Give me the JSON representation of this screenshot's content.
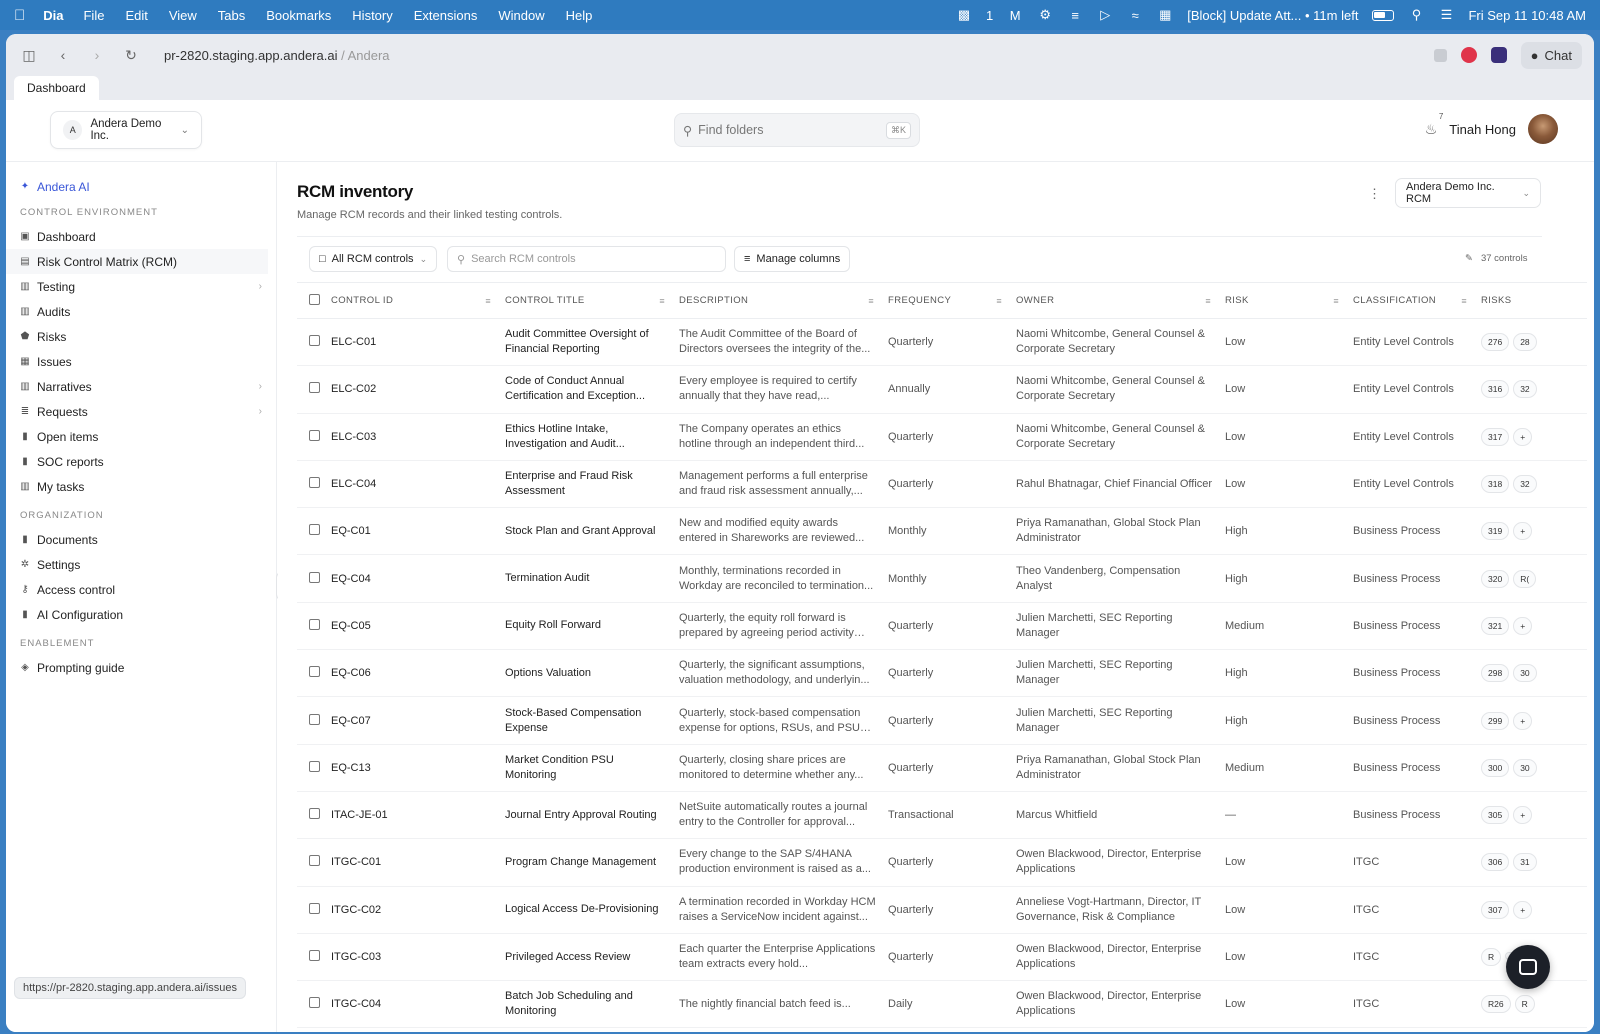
{
  "menubar": {
    "app": "Dia",
    "items": [
      "File",
      "Edit",
      "View",
      "Tabs",
      "Bookmarks",
      "History",
      "Extensions",
      "Window",
      "Help"
    ],
    "notif_count": "1",
    "meeting": "[Block] Update Att... • 11m left",
    "datetime": "Fri Sep 11  10:48 AM"
  },
  "browser": {
    "url_main": "pr-2820.staging.app.andera.ai",
    "url_sub": " / Andera",
    "chat_label": "Chat",
    "tab": "Dashboard",
    "status_url": "https://pr-2820.staging.app.andera.ai/issues"
  },
  "header": {
    "org_initial": "A",
    "org_name": "Andera Demo Inc.",
    "search_placeholder": "Find folders",
    "search_kbd": "⌘K",
    "notif_count": "7",
    "user_name": "Tinah Hong"
  },
  "sidebar": {
    "ai_label": "Andera AI",
    "section_control": "CONTROL ENVIRONMENT",
    "control_items": [
      {
        "label": "Dashboard",
        "icon": "▣"
      },
      {
        "label": "Risk Control Matrix (RCM)",
        "icon": "▤"
      },
      {
        "label": "Testing",
        "icon": "▥"
      },
      {
        "label": "Audits",
        "icon": "▥"
      },
      {
        "label": "Risks",
        "icon": "⬟"
      },
      {
        "label": "Issues",
        "icon": "▦"
      },
      {
        "label": "Narratives",
        "icon": "▥"
      },
      {
        "label": "Requests",
        "icon": "≣"
      },
      {
        "label": "Open items",
        "icon": "▮"
      },
      {
        "label": "SOC reports",
        "icon": "▮"
      },
      {
        "label": "My tasks",
        "icon": "▥"
      }
    ],
    "section_org": "ORGANIZATION",
    "org_items": [
      {
        "label": "Documents",
        "icon": "▮"
      },
      {
        "label": "Settings",
        "icon": "✲"
      },
      {
        "label": "Access control",
        "icon": "⚷"
      },
      {
        "label": "AI Configuration",
        "icon": "▮"
      }
    ],
    "section_enable": "ENABLEMENT",
    "enable_items": [
      {
        "label": "Prompting guide",
        "icon": "◈"
      }
    ]
  },
  "main": {
    "title": "RCM inventory",
    "subtitle": "Manage RCM records and their linked testing controls.",
    "rcm_select": "Andera Demo Inc. RCM",
    "filter_label": "All RCM controls",
    "search_placeholder": "Search RCM controls",
    "manage_columns": "Manage columns",
    "controls_count": "37 controls"
  },
  "table": {
    "headers": [
      "CONTROL ID",
      "CONTROL TITLE",
      "DESCRIPTION",
      "FREQUENCY",
      "OWNER",
      "RISK",
      "CLASSIFICATION",
      "RISKS"
    ],
    "rows": [
      {
        "id": "ELC-C01",
        "title": "Audit Committee Oversight of Financial Reporting",
        "desc": "The Audit Committee of the Board of Directors oversees the integrity of the...",
        "freq": "Quarterly",
        "owner": "Naomi Whitcombe, General Counsel & Corporate Secretary",
        "risk": "Low",
        "class": "Entity Level Controls",
        "risks": [
          "276",
          "28"
        ]
      },
      {
        "id": "ELC-C02",
        "title": "Code of Conduct Annual Certification and Exception...",
        "desc": "Every employee is required to certify annually that they have read,...",
        "freq": "Annually",
        "owner": "Naomi Whitcombe, General Counsel & Corporate Secretary",
        "risk": "Low",
        "class": "Entity Level Controls",
        "risks": [
          "316",
          "32"
        ]
      },
      {
        "id": "ELC-C03",
        "title": "Ethics Hotline Intake, Investigation and Audit...",
        "desc": "The Company operates an ethics hotline through an independent third...",
        "freq": "Quarterly",
        "owner": "Naomi Whitcombe, General Counsel & Corporate Secretary",
        "risk": "Low",
        "class": "Entity Level Controls",
        "risks": [
          "317",
          "+"
        ]
      },
      {
        "id": "ELC-C04",
        "title": "Enterprise and Fraud Risk Assessment",
        "desc": "Management performs a full enterprise and fraud risk assessment annually,...",
        "freq": "Quarterly",
        "owner": "Rahul Bhatnagar, Chief Financial Officer",
        "risk": "Low",
        "class": "Entity Level Controls",
        "risks": [
          "318",
          "32"
        ]
      },
      {
        "id": "EQ-C01",
        "title": "Stock Plan and Grant Approval",
        "desc": "New and modified equity awards entered in Shareworks are reviewed...",
        "freq": "Monthly",
        "owner": "Priya Ramanathan, Global Stock Plan Administrator",
        "risk": "High",
        "class": "Business Process",
        "risks": [
          "319",
          "+"
        ]
      },
      {
        "id": "EQ-C04",
        "title": "Termination Audit",
        "desc": "Monthly, terminations recorded in Workday are reconciled to termination...",
        "freq": "Monthly",
        "owner": "Theo Vandenberg, Compensation Analyst",
        "risk": "High",
        "class": "Business Process",
        "risks": [
          "320",
          "R("
        ]
      },
      {
        "id": "EQ-C05",
        "title": "Equity Roll Forward",
        "desc": "Quarterly, the equity roll forward is prepared by agreeing period activity —...",
        "freq": "Quarterly",
        "owner": "Julien Marchetti, SEC Reporting Manager",
        "risk": "Medium",
        "class": "Business Process",
        "risks": [
          "321",
          "+"
        ]
      },
      {
        "id": "EQ-C06",
        "title": "Options Valuation",
        "desc": "Quarterly, the significant assumptions, valuation methodology, and underlyin...",
        "freq": "Quarterly",
        "owner": "Julien Marchetti, SEC Reporting Manager",
        "risk": "High",
        "class": "Business Process",
        "risks": [
          "298",
          "30"
        ]
      },
      {
        "id": "EQ-C07",
        "title": "Stock-Based Compensation Expense",
        "desc": "Quarterly, stock-based compensation expense for options, RSUs, and PSUs i...",
        "freq": "Quarterly",
        "owner": "Julien Marchetti, SEC Reporting Manager",
        "risk": "High",
        "class": "Business Process",
        "risks": [
          "299",
          "+"
        ]
      },
      {
        "id": "EQ-C13",
        "title": "Market Condition PSU Monitoring",
        "desc": "Quarterly, closing share prices are monitored to determine whether any...",
        "freq": "Quarterly",
        "owner": "Priya Ramanathan, Global Stock Plan Administrator",
        "risk": "Medium",
        "class": "Business Process",
        "risks": [
          "300",
          "30"
        ]
      },
      {
        "id": "ITAC-JE-01",
        "title": "Journal Entry Approval Routing",
        "desc": "NetSuite automatically routes a journal entry to the Controller for approval...",
        "freq": "Transactional",
        "owner": "Marcus Whitfield",
        "risk": "—",
        "class": "Business Process",
        "risks": [
          "305",
          "+"
        ]
      },
      {
        "id": "ITGC-C01",
        "title": "Program Change Management",
        "desc": "Every change to the SAP S/4HANA production environment is raised as a...",
        "freq": "Quarterly",
        "owner": "Owen Blackwood, Director, Enterprise Applications",
        "risk": "Low",
        "class": "ITGC",
        "risks": [
          "306",
          "31"
        ]
      },
      {
        "id": "ITGC-C02",
        "title": "Logical Access De-Provisioning",
        "desc": "A termination recorded in Workday HCM raises a ServiceNow incident against...",
        "freq": "Quarterly",
        "owner": "Anneliese Vogt-Hartmann, Director, IT Governance, Risk & Compliance",
        "risk": "Low",
        "class": "ITGC",
        "risks": [
          "307",
          "+"
        ]
      },
      {
        "id": "ITGC-C03",
        "title": "Privileged Access Review",
        "desc": "Each quarter the Enterprise Applications team extracts every hold...",
        "freq": "Quarterly",
        "owner": "Owen Blackwood, Director, Enterprise Applications",
        "risk": "Low",
        "class": "ITGC",
        "risks": [
          "R",
          ""
        ]
      },
      {
        "id": "ITGC-C04",
        "title": "Batch Job Scheduling and Monitoring",
        "desc": "The nightly financial batch feed is...",
        "freq": "Daily",
        "owner": "Owen Blackwood, Director, Enterprise Applications",
        "risk": "Low",
        "class": "ITGC",
        "risks": [
          "R26",
          "R"
        ]
      }
    ]
  }
}
